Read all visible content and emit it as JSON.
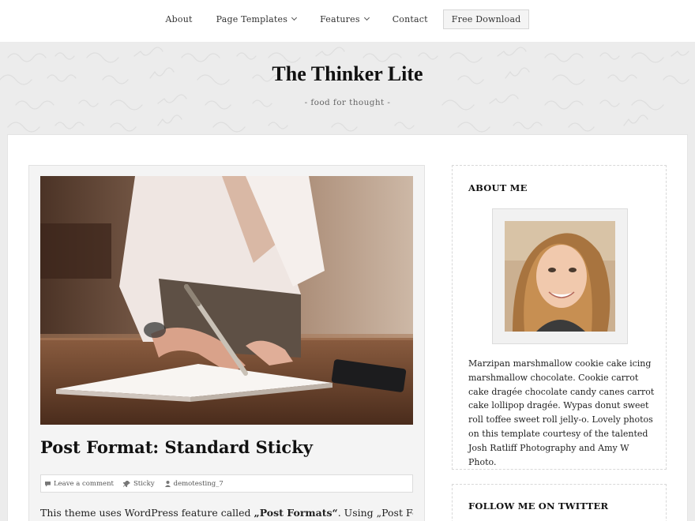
{
  "nav": {
    "items": [
      {
        "label": "About",
        "has_submenu": false
      },
      {
        "label": "Page Templates",
        "has_submenu": true
      },
      {
        "label": "Features",
        "has_submenu": true
      },
      {
        "label": "Contact",
        "has_submenu": false
      }
    ],
    "download_label": "Free Download"
  },
  "header": {
    "title": "The Thinker Lite",
    "tagline": "- food for thought -"
  },
  "post": {
    "title": "Post Format: Standard Sticky",
    "meta": {
      "comments": "Leave a comment",
      "sticky": "Sticky",
      "author": "demotesting_7"
    },
    "excerpt": {
      "before": "This theme uses WordPress feature called ",
      "bold": "„Post Formats“",
      "after": ". Using „Post Formats“"
    }
  },
  "sidebar": {
    "about": {
      "title": "ABOUT ME",
      "text": "Marzipan marshmallow cookie cake icing marshmallow chocolate. Cookie carrot cake dragée chocolate candy canes carrot cake lollipop dragée. Wypas donut sweet roll toffee sweet roll jelly-o. Lovely photos on this template courtesy of the talented Josh Ratliff Photography and Amy W Photo."
    },
    "twitter": {
      "title": "FOLLOW ME ON TWITTER"
    }
  },
  "colors": {
    "page_bg": "#ececec",
    "nav_bg": "#ffffff",
    "card_bg": "#f4f4f4",
    "text": "#222222"
  }
}
